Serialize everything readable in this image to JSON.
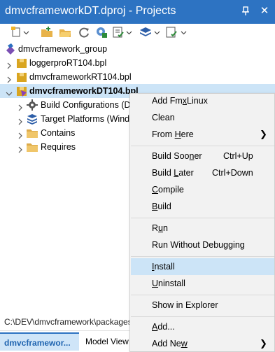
{
  "window": {
    "title": "dmvcframeworkDT.dproj - Projects",
    "pin_glyph": "📌",
    "close_glyph": "✕"
  },
  "toolbar": {
    "buttons": [
      "new-item-icon",
      "add-folder-icon",
      "open-folder-icon",
      "sync-icon",
      "build-config-icon",
      "checklist-icon",
      "layers-icon",
      "view-options-icon"
    ]
  },
  "tree": {
    "group": "dmvcframework_group",
    "items": [
      {
        "label": "loggerproRT104.bpl"
      },
      {
        "label": "dmvcframeworkRT104.bpl"
      },
      {
        "label": "dmvcframeworkDT104.bpl"
      }
    ],
    "children": [
      {
        "label": "Build Configurations (De"
      },
      {
        "label": "Target Platforms (Windo"
      },
      {
        "label": "Contains"
      },
      {
        "label": "Requires"
      }
    ]
  },
  "status": {
    "path": "C:\\DEV\\dmvcframework\\packages\\"
  },
  "tabs": {
    "active": "dmvcframewor...",
    "inactive": "Model View"
  },
  "menu": {
    "items": {
      "add_fmxlinux": {
        "pre": "Add Fm",
        "u": "x",
        "post": "Linux"
      },
      "clean": {
        "pre": "Clean",
        "u": "",
        "post": ""
      },
      "from_here": {
        "pre": "From ",
        "u": "H",
        "post": "ere",
        "submenu": "❯"
      },
      "build_sooner": {
        "pre": "Build Soo",
        "u": "n",
        "post": "er",
        "shortcut": "Ctrl+Up"
      },
      "build_later": {
        "pre": "Build ",
        "u": "L",
        "post": "ater",
        "shortcut": "Ctrl+Down"
      },
      "compile": {
        "pre": "",
        "u": "C",
        "post": "ompile"
      },
      "build": {
        "pre": "",
        "u": "B",
        "post": "uild"
      },
      "run": {
        "pre": "R",
        "u": "u",
        "post": "n"
      },
      "run_without_debugging": {
        "pre": "Run Without Debugging",
        "u": "",
        "post": ""
      },
      "install": {
        "pre": "",
        "u": "I",
        "post": "nstall"
      },
      "uninstall": {
        "pre": "",
        "u": "U",
        "post": "ninstall"
      },
      "show_in_explorer": {
        "pre": "Show in Explorer",
        "u": "",
        "post": ""
      },
      "add": {
        "pre": "",
        "u": "A",
        "post": "dd..."
      },
      "add_new": {
        "pre": "Add Ne",
        "u": "w",
        "post": "",
        "submenu": "❯"
      }
    }
  }
}
